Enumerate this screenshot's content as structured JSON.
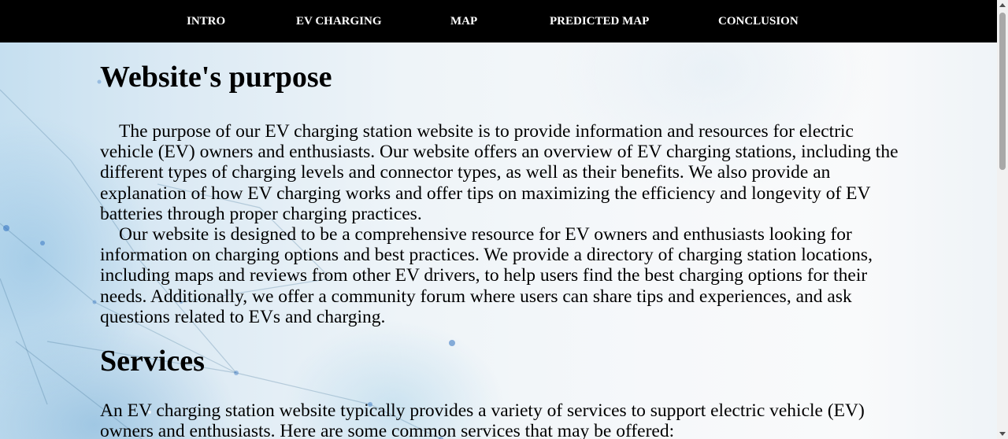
{
  "nav": {
    "items": [
      "INTRO",
      "EV CHARGING",
      "MAP",
      "PREDICTED MAP",
      "CONCLUSION"
    ]
  },
  "main": {
    "purpose_heading": "Website's purpose",
    "purpose_paragraphs": [
      "The purpose of our EV charging station website is to provide information and resources for electric vehicle (EV) owners and enthusiasts. Our website offers an overview of EV charging stations, including the different types of charging levels and connector types, as well as their benefits. We also provide an explanation of how EV charging works and offer tips on maximizing the efficiency and longevity of EV batteries through proper charging practices.",
      "Our website is designed to be a comprehensive resource for EV owners and enthusiasts looking for information on charging options and best practices. We provide a directory of charging station locations, including maps and reviews from other EV drivers, to help users find the best charging options for their needs. Additionally, we offer a community forum where users can share tips and experiences, and ask questions related to EVs and charging."
    ],
    "services_heading": "Services",
    "services_intro": "An EV charging station website typically provides a variety of services to support electric vehicle (EV) owners and enthusiasts. Here are some common services that may be offered:"
  },
  "colors": {
    "nav_background": "#000000",
    "nav_text": "#ffffff",
    "body_text": "#000000",
    "background_tint": "#c5dff0"
  }
}
